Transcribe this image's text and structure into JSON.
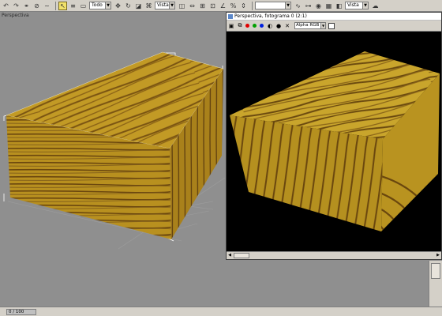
{
  "toolbar": {
    "tools": [
      "undo-icon",
      "redo-icon",
      "select-link-icon",
      "unlink-icon",
      "bind-space-warp-icon",
      "select-icon",
      "select-by-name-icon",
      "select-region-icon"
    ],
    "selection_filter": "Todo",
    "reference_coord": "Vista",
    "named_selection": "",
    "viewport_dropdown": "Vista"
  },
  "viewport": {
    "label": "Perspectiva"
  },
  "render_window": {
    "title": "Perspectiva, fotograma 0 (2:1)",
    "channel_select": "Alpha RGB",
    "channel_colors": [
      "#e00000",
      "#00a000",
      "#0020e0"
    ]
  },
  "timeline": {
    "frame_counter": "0 / 100"
  },
  "colors": {
    "wood_light": "#c8a028",
    "wood_dark": "#6b4a10",
    "viewport_bg": "#8f8f8f"
  }
}
